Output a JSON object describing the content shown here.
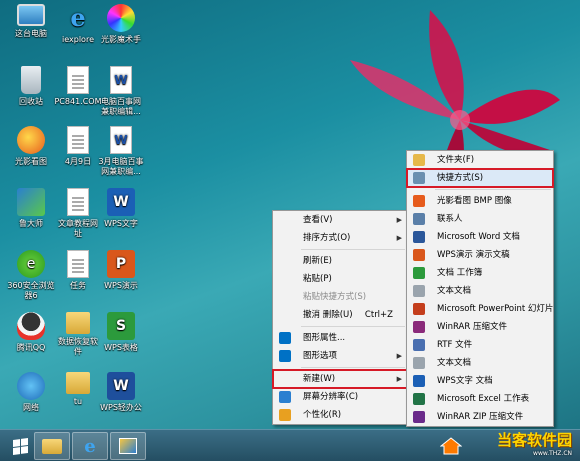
{
  "desktop": {
    "icons": [
      {
        "label": "这台电脑",
        "icon": "computer-icon"
      },
      {
        "label": "iexplore",
        "icon": "ie-icon"
      },
      {
        "label": "光影魔术手",
        "icon": "magic-icon"
      },
      {
        "label": "回收站",
        "icon": "recycle-bin-icon"
      },
      {
        "label": "PC841.COM",
        "icon": "document-icon"
      },
      {
        "label": "电脑百事网\n兼职编辑...",
        "icon": "word-doc-icon"
      },
      {
        "label": "光影看图",
        "icon": "photo-viewer-icon"
      },
      {
        "label": "4月9日",
        "icon": "document-icon"
      },
      {
        "label": "3月电脑百事\n网兼职编...",
        "icon": "word-doc-icon"
      },
      {
        "label": "鲁大师",
        "icon": "ludashi-icon"
      },
      {
        "label": "文章教程网\n址",
        "icon": "document-icon"
      },
      {
        "label": "WPS文字",
        "icon": "wps-writer-icon"
      },
      {
        "label": "360安全浏览\n器6",
        "icon": "browser-360-icon"
      },
      {
        "label": "任务",
        "icon": "document-icon"
      },
      {
        "label": "WPS演示",
        "icon": "wps-presentation-icon"
      },
      {
        "label": "腾讯QQ",
        "icon": "qq-icon"
      },
      {
        "label": "数据恢复软\n件",
        "icon": "folder-icon"
      },
      {
        "label": "WPS表格",
        "icon": "wps-spreadsheet-icon"
      },
      {
        "label": "网络",
        "icon": "network-icon"
      },
      {
        "label": "tu",
        "icon": "folder-icon"
      },
      {
        "label": "WPS轻办公",
        "icon": "wps-office-icon"
      }
    ]
  },
  "context_menu": {
    "items": [
      {
        "label": "查看(V)",
        "submenu": true
      },
      {
        "label": "排序方式(O)",
        "submenu": true
      },
      {
        "label": "刷新(E)"
      },
      {
        "label": "粘贴(P)"
      },
      {
        "label": "粘贴快捷方式(S)",
        "disabled": true
      },
      {
        "label": "撤消 删除(U)",
        "shortcut": "Ctrl+Z"
      },
      {
        "label": "图形属性...",
        "icon": "intel-icon"
      },
      {
        "label": "图形选项",
        "icon": "intel-icon",
        "submenu": true
      },
      {
        "label": "新建(W)",
        "submenu": true,
        "highlighted": true
      },
      {
        "label": "屏幕分辨率(C)",
        "icon": "display-icon"
      },
      {
        "label": "个性化(R)",
        "icon": "personalize-icon"
      }
    ]
  },
  "new_submenu": {
    "items": [
      {
        "label": "文件夹(F)",
        "icon": "folder-icon"
      },
      {
        "label": "快捷方式(S)",
        "icon": "shortcut-icon",
        "highlighted": true
      },
      {
        "label": "光影看图 BMP 图像",
        "icon": "bmp-icon"
      },
      {
        "label": "联系人",
        "icon": "contact-icon"
      },
      {
        "label": "Microsoft Word 文档",
        "icon": "word-icon"
      },
      {
        "label": "WPS演示 演示文稿",
        "icon": "wps-presentation-icon"
      },
      {
        "label": "文档 工作簿",
        "icon": "workbook-icon"
      },
      {
        "label": "文本文档",
        "icon": "text-icon"
      },
      {
        "label": "Microsoft PowerPoint 幻灯片",
        "icon": "powerpoint-icon"
      },
      {
        "label": "WinRAR 压缩文件",
        "icon": "winrar-icon"
      },
      {
        "label": "RTF 文件",
        "icon": "rtf-icon"
      },
      {
        "label": "文本文档",
        "icon": "text-icon"
      },
      {
        "label": "WPS文字 文档",
        "icon": "wps-writer-icon"
      },
      {
        "label": "Microsoft Excel 工作表",
        "icon": "excel-icon"
      },
      {
        "label": "WinRAR ZIP 压缩文件",
        "icon": "winrar-zip-icon"
      }
    ]
  },
  "taskbar": {
    "buttons": [
      "start-icon",
      "file-explorer-icon",
      "ie-icon",
      "app-icon"
    ]
  },
  "watermark": {
    "text": "当客软件园",
    "url": "www.THZ.CN"
  },
  "colors": {
    "highlight_box": "#d61a27",
    "menu_bg": "#f2f2f2",
    "hover": "#dbe9f7"
  }
}
